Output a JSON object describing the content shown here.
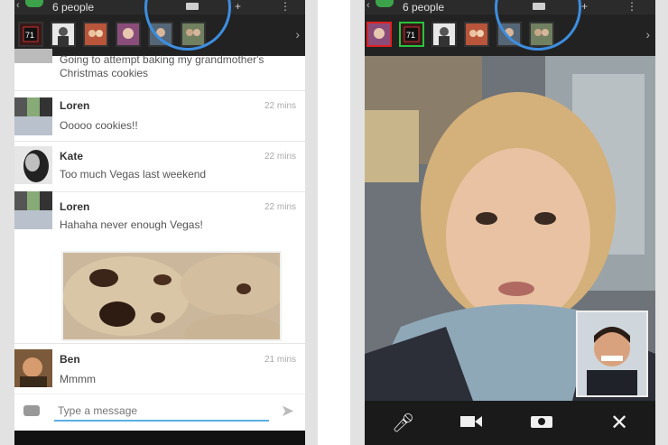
{
  "left": {
    "header": {
      "people_label": "6 people"
    },
    "messages": [
      {
        "sender": "",
        "time": "",
        "text": "Going to attempt baking my grandmother's",
        "text2": "Christmas cookies"
      },
      {
        "sender": "Loren",
        "time": "22 mins",
        "text": "Ooooo cookies!!"
      },
      {
        "sender": "Kate",
        "time": "22 mins",
        "text": "Too much Vegas last weekend"
      },
      {
        "sender": "Loren",
        "time": "22 mins",
        "text": "Hahaha never enough Vegas!"
      },
      {
        "sender": "Ben",
        "time": "21 mins",
        "text": "Mmmm"
      }
    ],
    "compose": {
      "placeholder": "Type a message"
    }
  },
  "right": {
    "header": {
      "people_label": "6 people"
    }
  },
  "colors": {
    "accent_blue": "#3d8ee0",
    "green": "#3da34a",
    "red_highlight": "#e02020",
    "green_highlight": "#27c43c"
  }
}
